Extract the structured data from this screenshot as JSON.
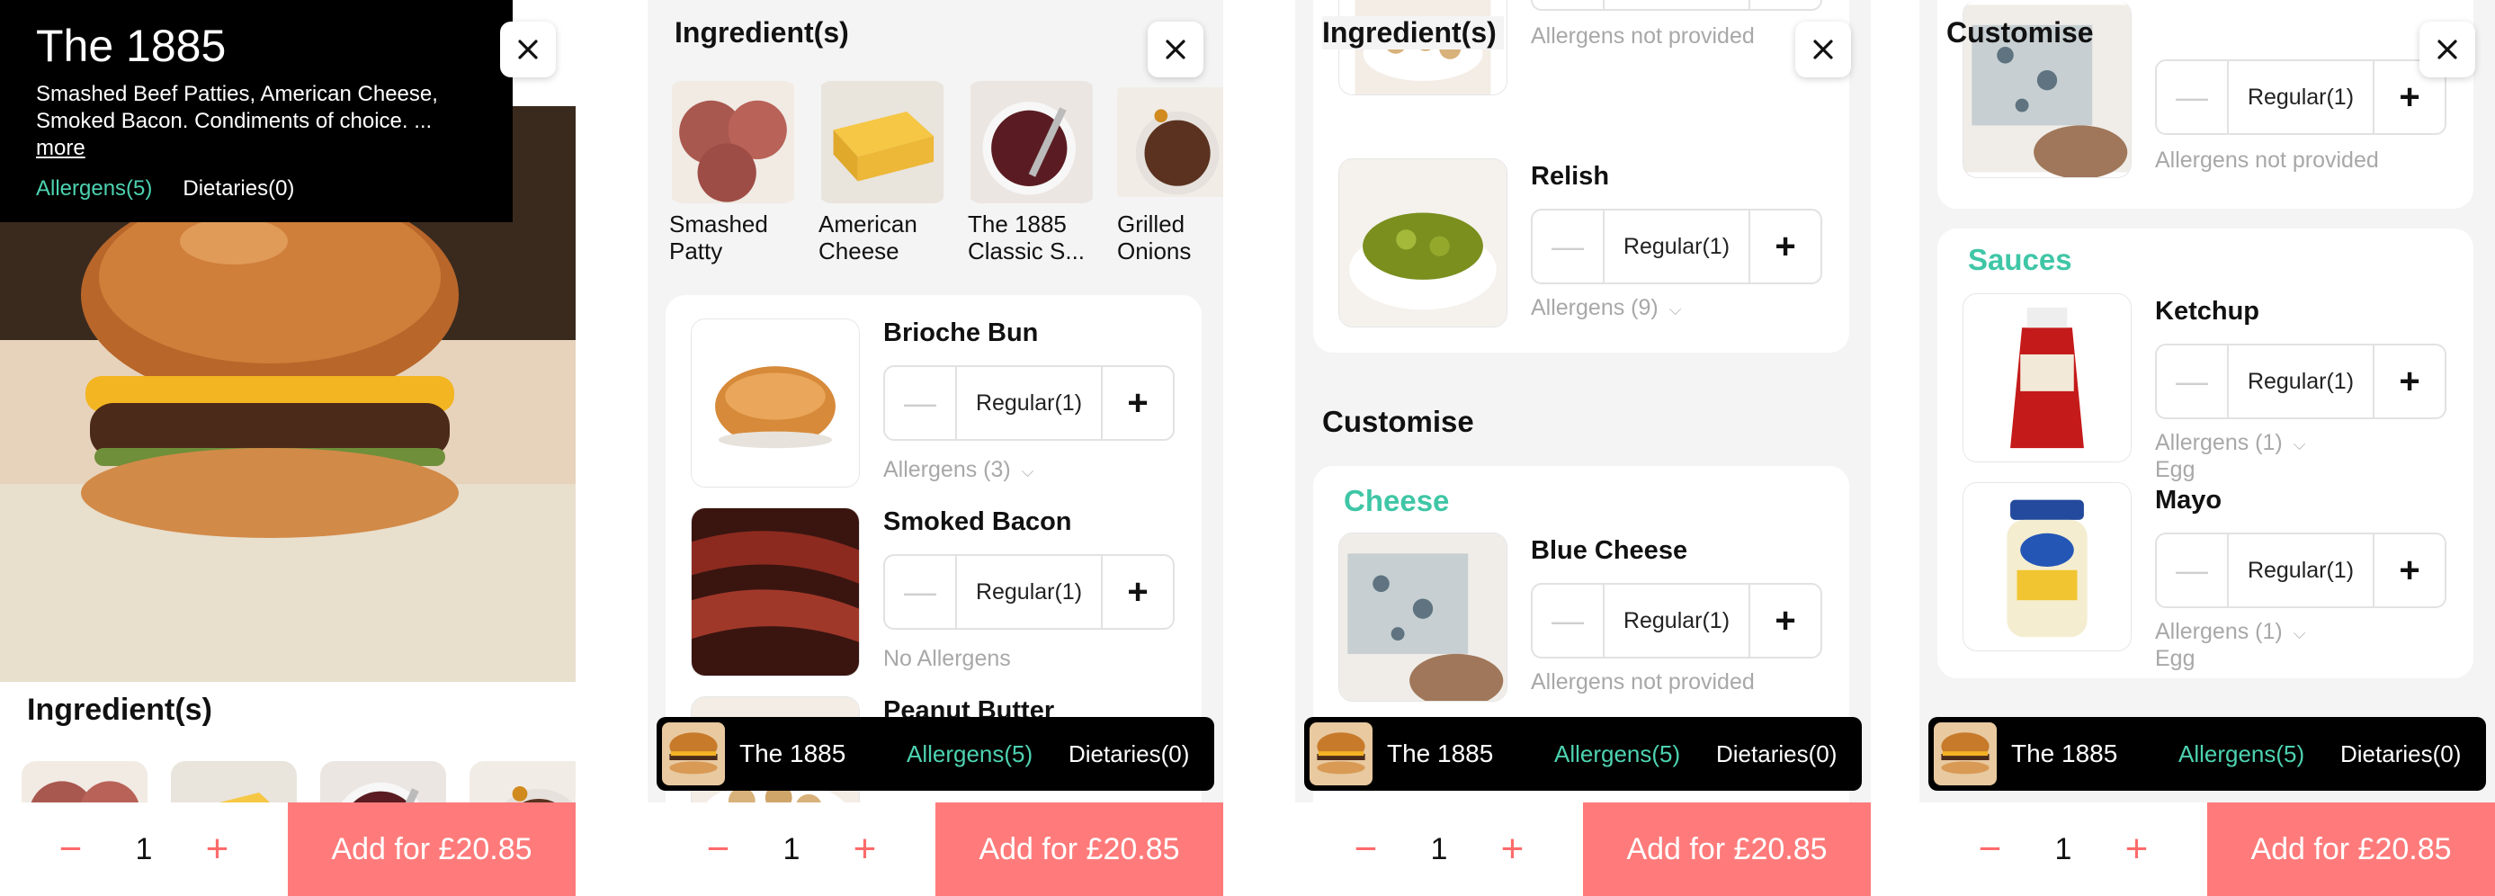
{
  "product": {
    "title": "The 1885",
    "desc_line1": "Smashed Beef Patties, American Cheese,",
    "desc_line2": "Smoked Bacon. Condiments of choice. ...",
    "more": "more",
    "allergens": "Allergens(5)",
    "dietaries": "Dietaries(0)"
  },
  "headings": {
    "ingredients": "Ingredient(s)",
    "customise": "Customise"
  },
  "thumbs": [
    {
      "line1": "Smashed",
      "line2": "Patty"
    },
    {
      "line1": "American",
      "line2": "Cheese"
    },
    {
      "line1": "The 1885",
      "line2": "Classic S..."
    },
    {
      "line1": "Grilled",
      "line2": "Onions"
    }
  ],
  "ingredients": {
    "bun": {
      "name": "Brioche Bun",
      "qty": "Regular(1)",
      "allergens": "Allergens (3)"
    },
    "bacon": {
      "name": "Smoked Bacon",
      "qty": "Regular(1)",
      "allergens": "No Allergens"
    },
    "peanut": {
      "name": "Peanut Butter"
    },
    "nuts": {
      "allergens": "Allergens not provided"
    },
    "relish": {
      "name": "Relish",
      "qty": "Regular(1)",
      "allergens": "Allergens (9)"
    }
  },
  "customise": {
    "cheese_title": "Cheese",
    "blue_cheese": {
      "name": "Blue Cheese",
      "qty": "Regular(1)",
      "allergens": "Allergens not provided"
    },
    "top_item": {
      "qty": "Regular(1)",
      "allergens": "Allergens not provided"
    },
    "sauces_title": "Sauces",
    "ketchup": {
      "name": "Ketchup",
      "qty": "Regular(1)",
      "allergens": "Allergens (1)",
      "sub": "Egg"
    },
    "mayo": {
      "name": "Mayo",
      "qty": "Regular(1)",
      "allergens": "Allergens (1)",
      "sub": "Egg"
    }
  },
  "bar": {
    "name": "The 1885",
    "allergens": "Allergens(5)",
    "dietaries": "Dietaries(0)"
  },
  "bottom": {
    "minus": "−",
    "qty": "1",
    "plus": "+",
    "add_label": "Add for £20.85"
  },
  "stepper": {
    "minus": "—",
    "plus": "+"
  },
  "colors": {
    "accent": "#ff7b7b",
    "teal": "#3fc6a6",
    "dark": "#000000"
  }
}
